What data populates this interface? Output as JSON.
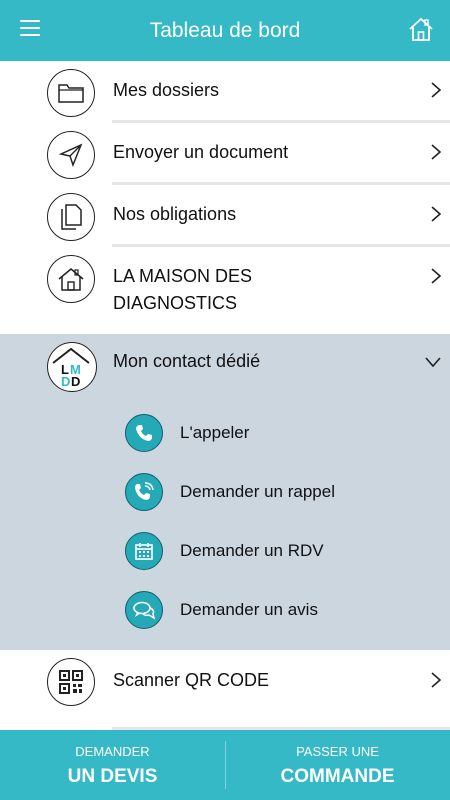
{
  "header": {
    "title": "Tableau de bord",
    "menu_icon": "hamburger-icon",
    "home_icon": "home-icon"
  },
  "menu": {
    "items": [
      {
        "label": "Mes dossiers",
        "icon": "folder-icon"
      },
      {
        "label": "Envoyer un document",
        "icon": "send-icon"
      },
      {
        "label": "Nos obligations",
        "icon": "documents-icon"
      },
      {
        "label_line1": "LA MAISON DES",
        "label_line2": "DIAGNOSTICS",
        "icon": "house-icon"
      }
    ]
  },
  "contact": {
    "label": "Mon contact dédié",
    "logo_text": "LMDD",
    "actions": [
      {
        "label": "L'appeler",
        "icon": "phone-icon"
      },
      {
        "label": "Demander un rappel",
        "icon": "callback-icon"
      },
      {
        "label": "Demander un RDV",
        "icon": "calendar-icon"
      },
      {
        "label": "Demander un avis",
        "icon": "chat-icon"
      }
    ]
  },
  "scanner": {
    "label": "Scanner QR CODE",
    "icon": "qr-code-icon"
  },
  "footer": {
    "quote": {
      "small": "DEMANDER",
      "big": "UN DEVIS"
    },
    "order": {
      "small": "PASSER UNE",
      "big": "COMMANDE"
    }
  },
  "colors": {
    "accent": "#35b9c6",
    "contact_bg": "#ccd6df",
    "action_dot": "#25a9b7"
  }
}
